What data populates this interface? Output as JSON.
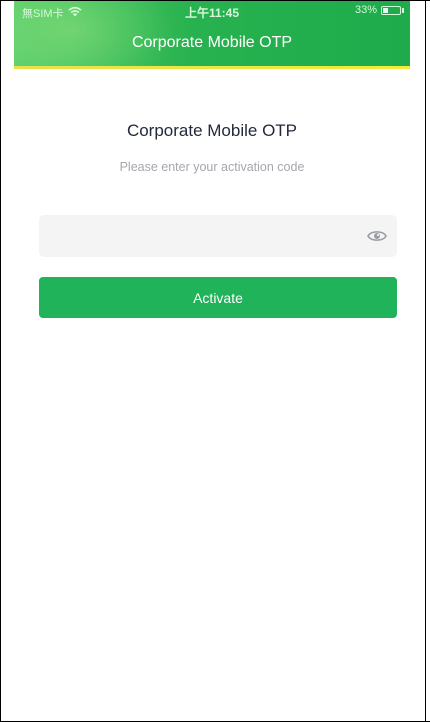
{
  "status_bar": {
    "carrier": "無SIM卡",
    "time": "上午11:45",
    "battery_percent": "33%",
    "battery_level": 0.33,
    "icons": [
      "wifi-icon",
      "battery-icon"
    ]
  },
  "header": {
    "title": "Corporate Mobile OTP",
    "colors": {
      "gradient_start": "#5dcf6d",
      "gradient_end": "#1dab4b",
      "accent_line": "#f3ea3b"
    }
  },
  "main": {
    "title": "Corporate Mobile OTP",
    "subtitle": "Please enter your activation code",
    "activation_input": {
      "value": "",
      "placeholder": ""
    },
    "visibility_toggle_icon": "eye-icon",
    "activate_label": "Activate",
    "button_color": "#20b359"
  }
}
